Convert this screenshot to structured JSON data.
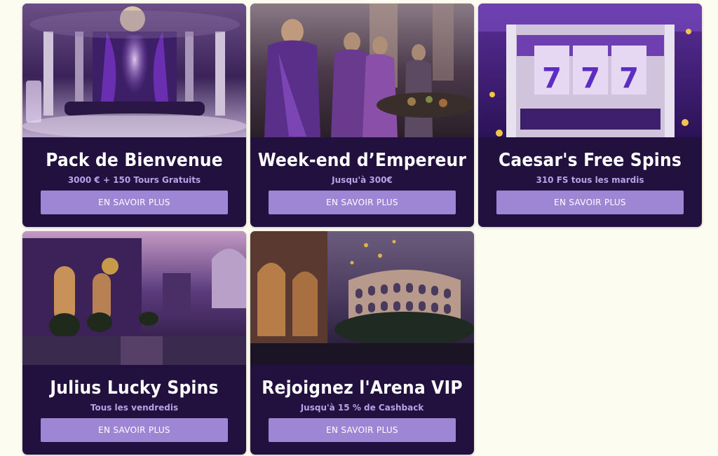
{
  "colors": {
    "page_background": "#fdfcf1",
    "card_background": "#22103f",
    "button_background": "#9f86d4",
    "subtitle_text": "#b7a3e6",
    "title_text": "#ffffff"
  },
  "promotions": [
    {
      "title": "Pack de Bienvenue",
      "subtitle": "3000 € + 150 Tours Gratuits",
      "button_label": "EN SAVOIR PLUS",
      "image": "luxury-casino-hall-image"
    },
    {
      "title": "Week-end d’Empereur",
      "subtitle": "Jusqu'à 300€",
      "button_label": "EN SAVOIR PLUS",
      "image": "roman-feast-crowd-image"
    },
    {
      "title": "Caesar's Free Spins",
      "subtitle": "310 FS tous les mardis",
      "button_label": "EN SAVOIR PLUS",
      "image": "slot-machine-777-image"
    },
    {
      "title": "Julius Lucky Spins",
      "subtitle": "Tous les vendredis",
      "button_label": "EN SAVOIR PLUS",
      "image": "roman-palace-evening-image"
    },
    {
      "title": "Rejoignez l'Arena VIP",
      "subtitle": "Jusqu'à 15 % de Cashback",
      "button_label": "EN SAVOIR PLUS",
      "image": "colosseum-night-image"
    }
  ]
}
